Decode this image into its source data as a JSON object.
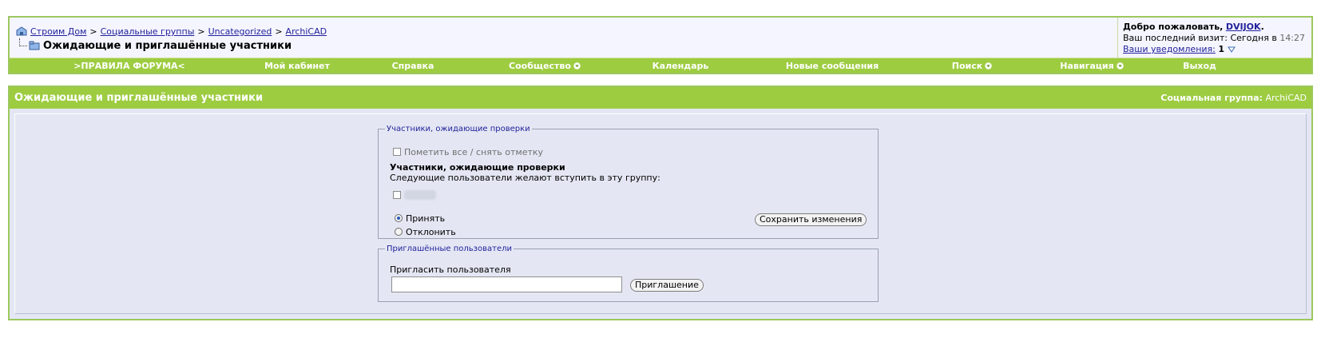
{
  "breadcrumb": {
    "items": [
      "Строим Дом",
      "Социальные группы",
      "Uncategorized",
      "ArchiCAD"
    ],
    "separator": ">"
  },
  "page_title": "Ожидающие и приглашённые участники",
  "user_panel": {
    "welcome_prefix": "Добро пожаловать,",
    "username": "DVIJOK",
    "username_suffix": ".",
    "last_visit_label": "Ваш последний визит: Сегодня в",
    "last_visit_time": "14:27",
    "notifications_label": "Ваши уведомления:",
    "notifications_count": "1"
  },
  "menu": {
    "items": [
      {
        "label": ">ПРАВИЛА ФОРУМА<",
        "dropdown": false
      },
      {
        "label": "Мой кабинет",
        "dropdown": false
      },
      {
        "label": "Справка",
        "dropdown": false
      },
      {
        "label": "Сообщество",
        "dropdown": true
      },
      {
        "label": "Календарь",
        "dropdown": false
      },
      {
        "label": "Новые сообщения",
        "dropdown": false
      },
      {
        "label": "Поиск",
        "dropdown": true
      },
      {
        "label": "Навигация",
        "dropdown": true
      },
      {
        "label": "Выход",
        "dropdown": false
      }
    ]
  },
  "block": {
    "title": "Ожидающие и приглашённые участники",
    "group_label": "Социальная группа:",
    "group_name": "ArchiCAD"
  },
  "pending": {
    "legend": "Участники, ожидающие проверки",
    "select_all_label": "Пометить все / снять отметку",
    "heading": "Участники, ожидающие проверки",
    "description": "Следующие пользователи желают вступить в эту группу:",
    "accept_label": "Принять",
    "reject_label": "Отклонить",
    "save_button": "Сохранить изменения"
  },
  "invited": {
    "legend": "Приглашённые пользователи",
    "invite_label": "Пригласить пользователя",
    "invite_value": "",
    "invite_button": "Приглашение"
  },
  "colors": {
    "accent_green": "#9dcc41",
    "border_green": "#9dc85e",
    "link_blue": "#22229c",
    "panel_bg": "#e4e7f3"
  }
}
